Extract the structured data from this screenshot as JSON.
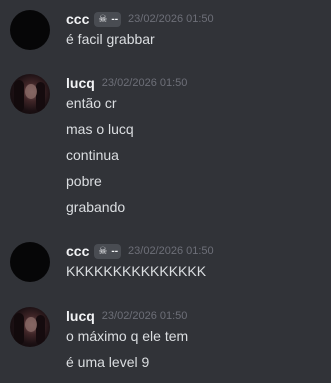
{
  "messages": [
    {
      "username": "ccc",
      "has_tag": true,
      "tag_icon": "skull-icon",
      "tag_text": "--",
      "timestamp": "23/02/2026 01:50",
      "avatar": "dark-circle",
      "lines": [
        "é facil grabbar"
      ]
    },
    {
      "username": "lucq",
      "has_tag": false,
      "timestamp": "23/02/2026 01:50",
      "avatar": "photo",
      "lines": [
        "então cr",
        "mas o lucq",
        "continua",
        "pobre",
        "grabando"
      ]
    },
    {
      "username": "ccc",
      "has_tag": true,
      "tag_icon": "skull-icon",
      "tag_text": "--",
      "timestamp": "23/02/2026 01:50",
      "avatar": "dark-circle",
      "lines": [
        "KKKKKKKKKKKKKKK"
      ]
    },
    {
      "username": "lucq",
      "has_tag": false,
      "timestamp": "23/02/2026 01:50",
      "avatar": "photo",
      "lines": [
        "o máximo q ele tem",
        "é uma level 9"
      ]
    }
  ],
  "colors": {
    "background": "#313338",
    "username": "#f2f3f5",
    "message_text": "#dbdee1",
    "timestamp": "#6d6f78",
    "tag_background": "#494c52"
  }
}
